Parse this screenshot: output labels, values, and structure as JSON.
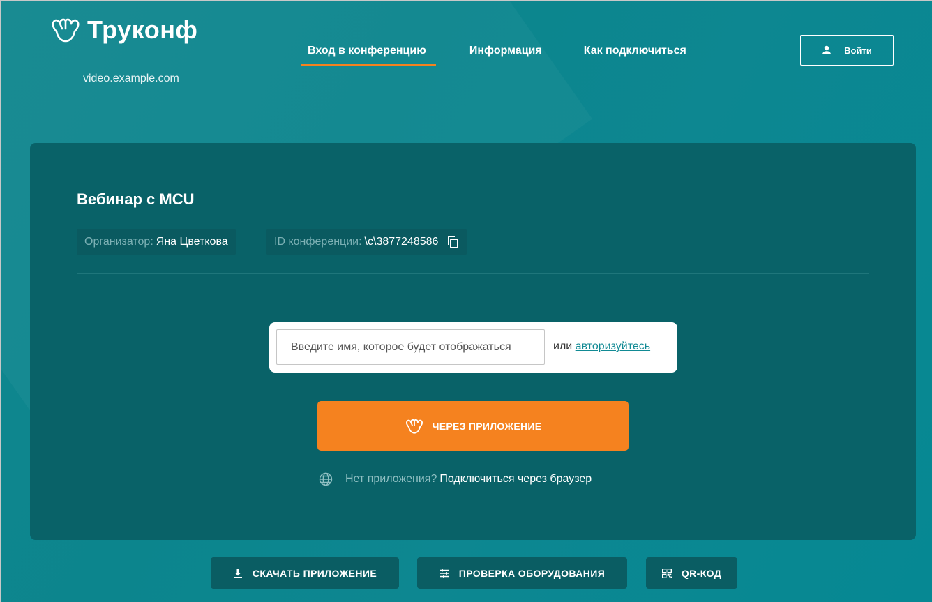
{
  "header": {
    "brand_name": "Труконф",
    "domain": "video.example.com",
    "nav": [
      {
        "label": "Вход в конференцию",
        "active": true
      },
      {
        "label": "Информация",
        "active": false
      },
      {
        "label": "Как подключиться",
        "active": false
      }
    ],
    "login_label": "Войти"
  },
  "conference": {
    "title": "Вебинар с MCU",
    "organizer_label": "Организатор:",
    "organizer_name": "Яна Цветкова",
    "id_label": "ID конференции:",
    "id_value": "\\c\\3877248586"
  },
  "join": {
    "name_placeholder": "Введите имя, которое будет отображаться",
    "or_text": "или",
    "auth_link": "авторизуйтесь",
    "app_button": "ЧЕРЕЗ ПРИЛОЖЕНИЕ",
    "no_app_text": "Нет приложения?",
    "browser_link": "Подключиться через браузер"
  },
  "footer": {
    "download_label": "СКАЧАТЬ ПРИЛОЖЕНИЕ",
    "check_label": "ПРОВЕРКА ОБОРУДОВАНИЯ",
    "qr_label": "QR-КОД"
  },
  "colors": {
    "accent": "#f5821f",
    "background": "#0c858d",
    "card": "#096268"
  },
  "icons": [
    "trueconf-logo-icon",
    "user-icon",
    "copy-icon",
    "trueconf-app-icon",
    "globe-icon",
    "download-icon",
    "sliders-icon",
    "qr-code-icon"
  ]
}
